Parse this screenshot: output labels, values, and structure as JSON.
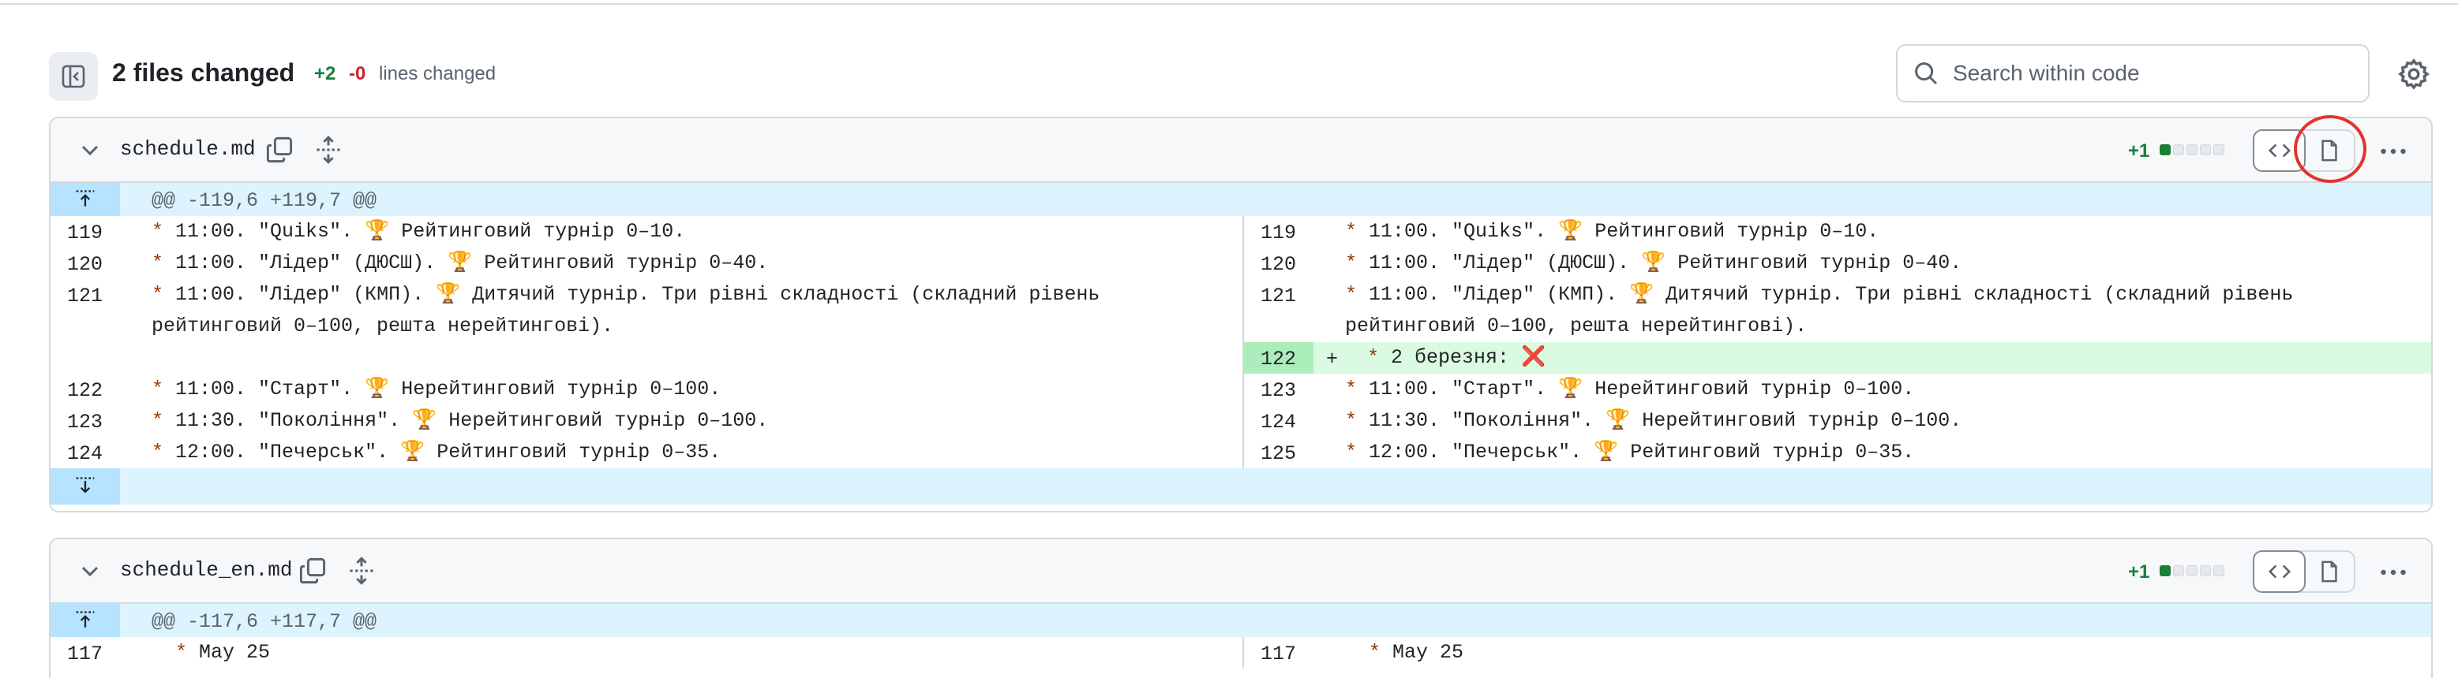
{
  "summary": {
    "files_changed": "2 files changed",
    "additions": "+2",
    "deletions": "-0",
    "lines_changed_label": "lines changed"
  },
  "search": {
    "placeholder": "Search within code"
  },
  "files": [
    {
      "name": "schedule.md",
      "diffstat": "+1",
      "hunk_header": "@@ -119,6 +119,7 @@",
      "left_rows": [
        {
          "ln": "119",
          "text": "11:00. \"Quiks\". 🏆 Рейтинговий турнір 0–10."
        },
        {
          "ln": "120",
          "text": "11:00. \"Лідер\" (ДЮСШ). 🏆 Рейтинговий турнір 0–40."
        },
        {
          "ln": "121",
          "text": "11:00. \"Лідер\" (КМП). 🏆 Дитячий турнір. Три рівні складності (складний рівень рейтинговий 0–100, решта нерейтингові)."
        },
        {
          "ln": "",
          "text": ""
        },
        {
          "ln": "122",
          "text": "11:00. \"Старт\". 🏆 Нерейтинговий турнір 0–100."
        },
        {
          "ln": "123",
          "text": "11:30. \"Покоління\". 🏆 Нерейтинговий турнір 0–100."
        },
        {
          "ln": "124",
          "text": "12:00. \"Печерськ\". 🏆 Рейтинговий турнір 0–35."
        }
      ],
      "right_rows": [
        {
          "ln": "119",
          "text": "11:00. \"Quiks\". 🏆 Рейтинговий турнір 0–10."
        },
        {
          "ln": "120",
          "text": "11:00. \"Лідер\" (ДЮСШ). 🏆 Рейтинговий турнір 0–40."
        },
        {
          "ln": "121",
          "text": "11:00. \"Лідер\" (КМП). 🏆 Дитячий турнір. Три рівні складності (складний рівень рейтинговий 0–100, решта нерейтингові)."
        },
        {
          "ln": "122",
          "marker": "+",
          "text": "2 березня: ❌"
        },
        {
          "ln": "123",
          "text": "11:00. \"Старт\". 🏆 Нерейтинговий турнір 0–100."
        },
        {
          "ln": "124",
          "text": "11:30. \"Покоління\". 🏆 Нерейтинговий турнір 0–100."
        },
        {
          "ln": "125",
          "text": "12:00. \"Печерськ\". 🏆 Рейтинговий турнір 0–35."
        }
      ]
    },
    {
      "name": "schedule_en.md",
      "diffstat": "+1",
      "hunk_header": "@@ -117,6 +117,7 @@",
      "left_rows": [
        {
          "ln": "117",
          "text": "May 25"
        }
      ],
      "right_rows": [
        {
          "ln": "117",
          "text": "May 25"
        }
      ]
    }
  ],
  "list_star": "*",
  "colors": {
    "addition": "#1a7f37",
    "deletion": "#cf222e",
    "hunk_bg": "#ddf4ff",
    "added_line_bg": "#dafbe1",
    "highlight_ring": "#e5322d"
  },
  "icons": {
    "tree_toggle": "sidebar-collapse-icon",
    "search": "search-icon",
    "settings": "gear-icon",
    "collapse": "chevron-down-icon",
    "copy": "copy-icon",
    "expand_all": "unfold-icon",
    "code_view": "code-icon",
    "file_view": "file-icon",
    "more": "kebab-horizontal-icon",
    "expand_up": "expand-up-icon",
    "expand_down": "expand-down-icon"
  }
}
